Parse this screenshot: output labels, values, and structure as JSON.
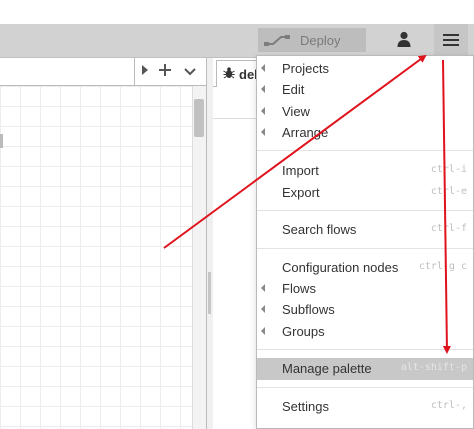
{
  "header": {
    "deploy_label": "Deploy"
  },
  "sidebar": {
    "tab_label": "deb"
  },
  "menu": {
    "items": [
      {
        "label": "Projects",
        "submenu": true,
        "shortcut": ""
      },
      {
        "label": "Edit",
        "submenu": true,
        "shortcut": ""
      },
      {
        "label": "View",
        "submenu": true,
        "shortcut": ""
      },
      {
        "label": "Arrange",
        "submenu": true,
        "shortcut": ""
      },
      {
        "label": "Import",
        "submenu": false,
        "shortcut": "ctrl-i"
      },
      {
        "label": "Export",
        "submenu": false,
        "shortcut": "ctrl-e"
      },
      {
        "label": "Search flows",
        "submenu": false,
        "shortcut": "ctrl-f"
      },
      {
        "label": "Configuration nodes",
        "submenu": false,
        "shortcut": "ctrl-g c"
      },
      {
        "label": "Flows",
        "submenu": true,
        "shortcut": ""
      },
      {
        "label": "Subflows",
        "submenu": true,
        "shortcut": ""
      },
      {
        "label": "Groups",
        "submenu": true,
        "shortcut": ""
      },
      {
        "label": "Manage palette",
        "submenu": false,
        "shortcut": "alt-shift-p",
        "highlighted": true
      },
      {
        "label": "Settings",
        "submenu": false,
        "shortcut": "ctrl-,"
      }
    ]
  },
  "annotations": {
    "arrow_color": "#e0121c"
  }
}
